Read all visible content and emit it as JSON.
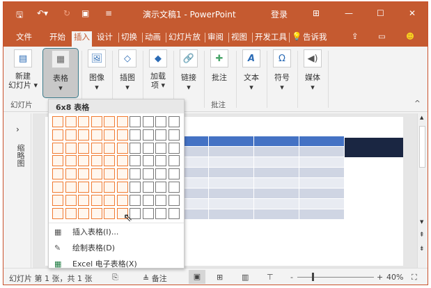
{
  "title_bar": {
    "doc_title": "演示文稿1 - PowerPoint",
    "login": "登录",
    "minimize": "—",
    "maximize": "☐",
    "close": "✕"
  },
  "tabs": [
    "文件",
    "开始",
    "插入",
    "设计",
    "切换",
    "动画",
    "幻灯片放",
    "审阅",
    "视图",
    "开发工具",
    "告诉我"
  ],
  "ribbon": {
    "buttons": [
      {
        "label": "新建\n幻灯片 ▾",
        "icon": "new-slide-icon"
      },
      {
        "label": "表格",
        "icon": "table-icon"
      },
      {
        "label": "图像",
        "icon": "image-icon"
      },
      {
        "label": "插图",
        "icon": "illustration-icon"
      },
      {
        "label": "加载\n项 ▾",
        "icon": "addins-icon"
      },
      {
        "label": "链接",
        "icon": "link-icon"
      },
      {
        "label": "批注",
        "icon": "comment-icon"
      },
      {
        "label": "文本",
        "icon": "text-icon"
      },
      {
        "label": "符号",
        "icon": "symbol-icon"
      },
      {
        "label": "媒体",
        "icon": "media-icon"
      }
    ],
    "groups": [
      "幻灯片",
      "批注"
    ]
  },
  "table_dropdown": {
    "header": "6x8 表格",
    "columns": 10,
    "rows": 8,
    "selected_columns": 6,
    "selected_rows": 8,
    "menu": [
      "插入表格(I)...",
      "绘制表格(D)",
      "Excel 电子表格(X)"
    ]
  },
  "thumbnail_pane": {
    "label": "缩略图",
    "expand": "›"
  },
  "status_bar": {
    "slide_info": "幻灯片 第 1 张，共 1 张",
    "notes": "备注",
    "zoom": "40%"
  },
  "colors": {
    "accent": "#c55a30",
    "table_header": "#4472c4",
    "grid_highlight": "#f07a30"
  }
}
